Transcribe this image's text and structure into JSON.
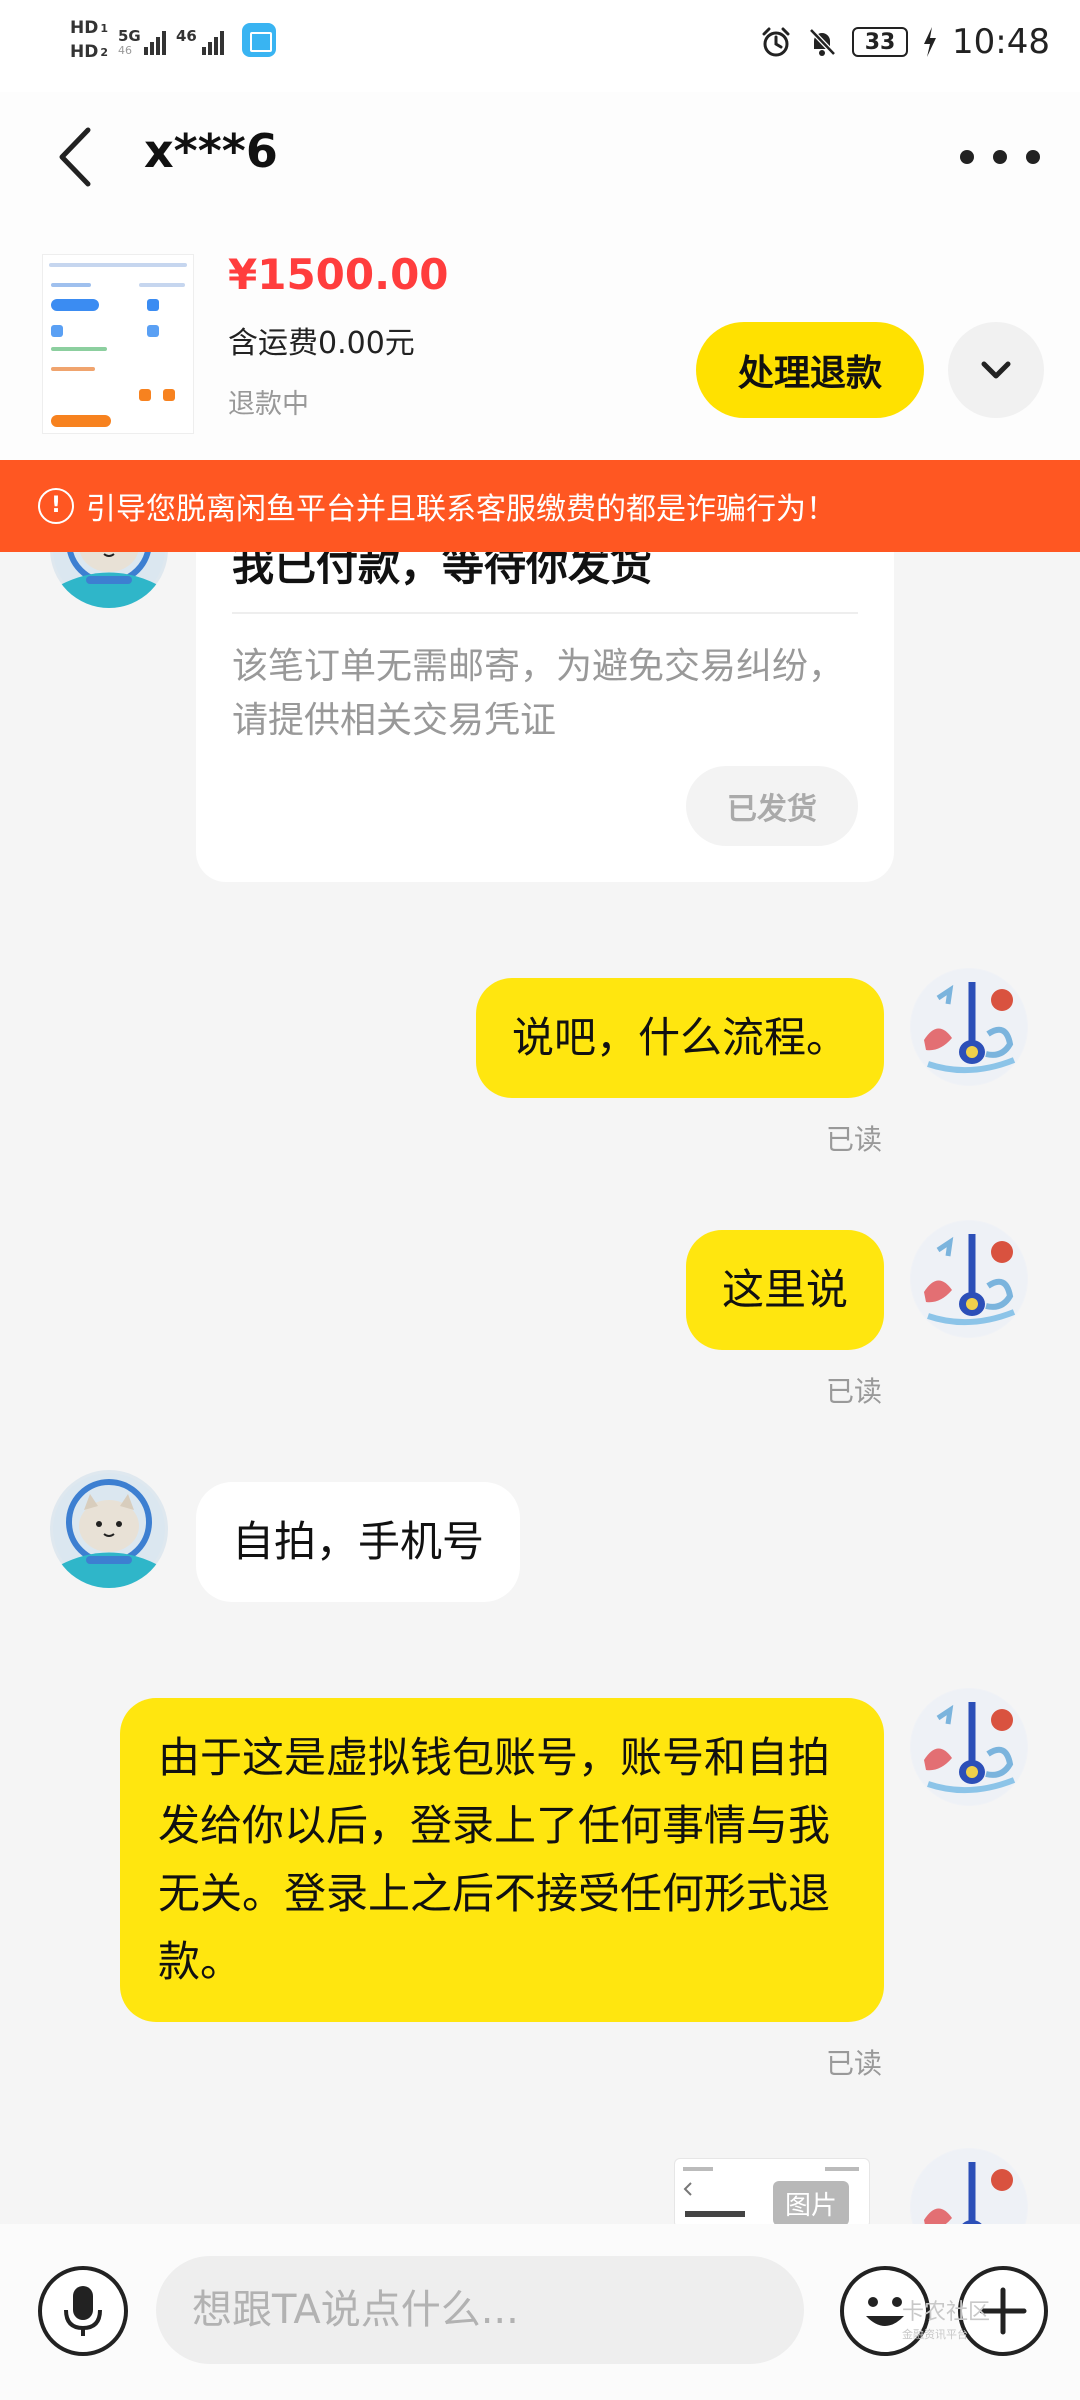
{
  "status_bar": {
    "network_1": "HD",
    "network_1_sub": "1",
    "network_2": "HD",
    "network_2_sub": "2",
    "signal_1_label": "5G",
    "signal_1_sub": "46",
    "signal_2_label": "46",
    "battery": "33",
    "time": "10:48"
  },
  "header": {
    "title": "x***6"
  },
  "product": {
    "price": "¥1500.00",
    "shipping": "含运费0.00元",
    "status": "退款中",
    "refund_button": "处理退款"
  },
  "warning": {
    "icon": "!",
    "text": "引导您脱离闲鱼平台并且联系客服缴费的都是诈骗行为！"
  },
  "order_card": {
    "title": "我已付款，等待你发货",
    "description": "该笔订单无需邮寄，为避免交易纠纷，请提供相关交易凭证",
    "shipped_button": "已发货"
  },
  "messages": [
    {
      "from": "me",
      "text": "说吧，什么流程。",
      "status": "已读"
    },
    {
      "from": "me",
      "text": "这里说",
      "status": "已读"
    },
    {
      "from": "them",
      "text": "自拍，手机号"
    },
    {
      "from": "me",
      "text": "由于这是虚拟钱包账号，账号和自拍发给你以后，登录上了任何事情与我无关。登录上之后不接受任何形式退款。",
      "status": "已读"
    },
    {
      "from": "me",
      "image_label": "图片"
    }
  ],
  "input": {
    "placeholder": "想跟TA说点什么..."
  },
  "watermark": {
    "text": "卡农社区",
    "sub": "金融资讯平台"
  },
  "colors": {
    "accent_yellow": "#ffe60f",
    "warning_orange": "#ff5722",
    "price_red": "#ff3d3d"
  }
}
